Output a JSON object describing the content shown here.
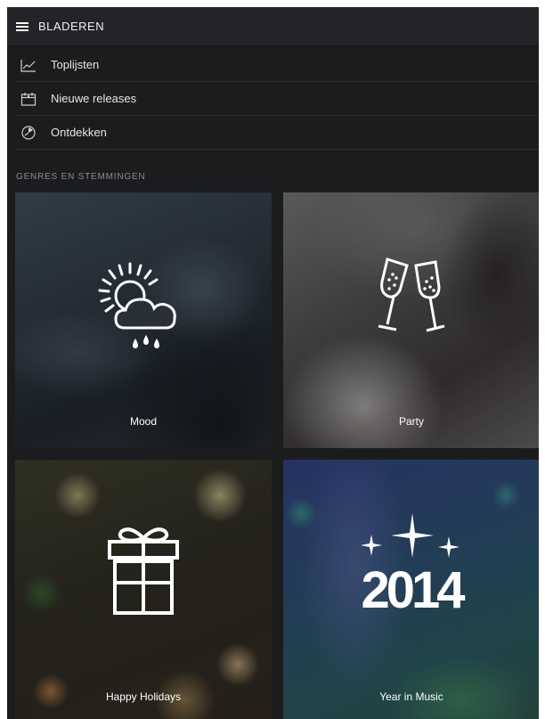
{
  "header": {
    "title": "BLADEREN",
    "menu_icon": "hamburger-menu-icon"
  },
  "menu": [
    {
      "label": "Toplijsten",
      "icon": "chart-line-icon"
    },
    {
      "label": "Nieuwe releases",
      "icon": "calendar-icon"
    },
    {
      "label": "Ontdekken",
      "icon": "compass-icon"
    }
  ],
  "section": {
    "title": "GENRES EN STEMMINGEN"
  },
  "tiles": [
    {
      "label": "Mood",
      "icon": "sun-cloud-rain-icon"
    },
    {
      "label": "Party",
      "icon": "champagne-glasses-icon"
    },
    {
      "label": "Happy Holidays",
      "icon": "gift-icon"
    },
    {
      "label": "Year in Music",
      "icon": "year-2014-icon",
      "year_text": "2014"
    }
  ]
}
